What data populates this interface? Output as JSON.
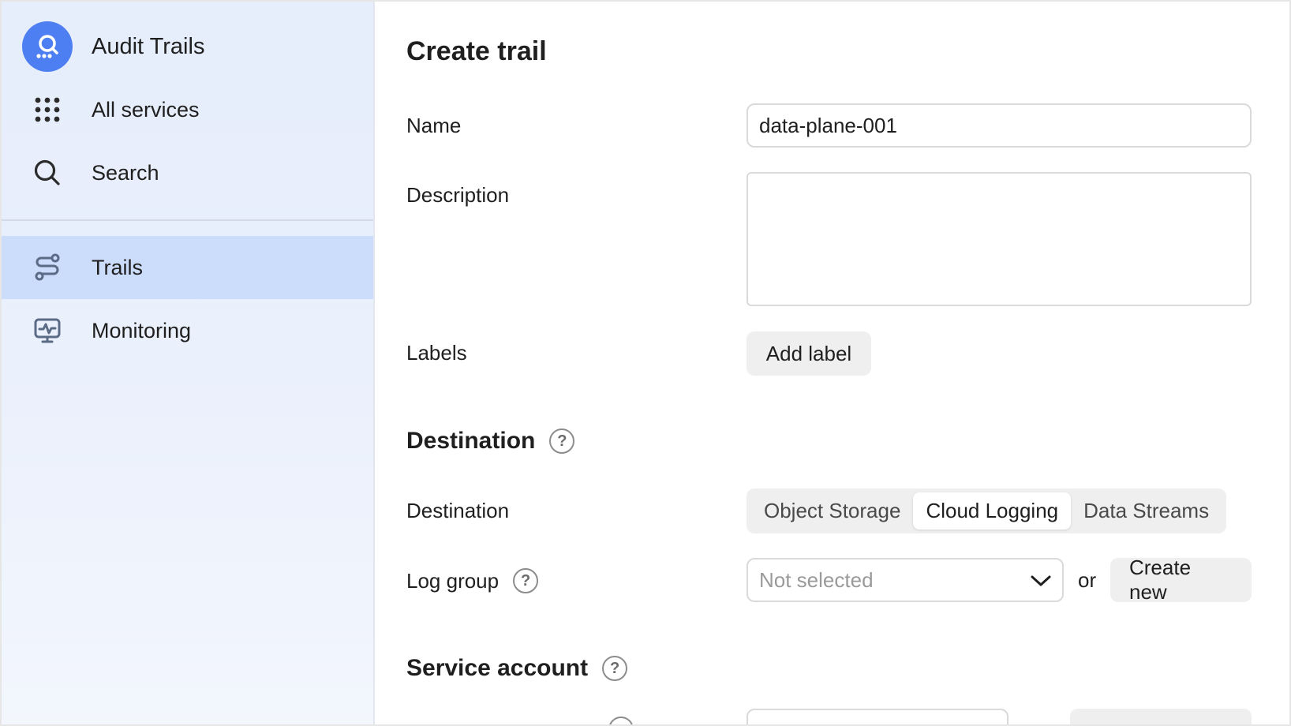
{
  "sidebar": {
    "brand_label": "Audit Trails",
    "items": [
      {
        "label": "All services",
        "icon": "grid-icon"
      },
      {
        "label": "Search",
        "icon": "search-icon"
      },
      {
        "label": "Trails",
        "icon": "trails-icon",
        "active": true
      },
      {
        "label": "Monitoring",
        "icon": "monitoring-icon"
      }
    ]
  },
  "form": {
    "title": "Create trail",
    "name": {
      "label": "Name",
      "value": "data-plane-001"
    },
    "description": {
      "label": "Description",
      "value": ""
    },
    "labels": {
      "label": "Labels",
      "button": "Add label"
    },
    "destination_section": {
      "title": "Destination"
    },
    "destination": {
      "label": "Destination",
      "options": [
        "Object Storage",
        "Cloud Logging",
        "Data Streams"
      ],
      "selected": "Cloud Logging"
    },
    "log_group": {
      "label": "Log group",
      "placeholder": "Not selected",
      "or_text": "or",
      "create_button": "Create new"
    },
    "service_account_section": {
      "title": "Service account"
    }
  },
  "colors": {
    "accent": "#4e7ff2",
    "active_nav_bg": "#ccdcfb",
    "sidebar_bg": "#e6edfb",
    "button_bg": "#efefef"
  }
}
